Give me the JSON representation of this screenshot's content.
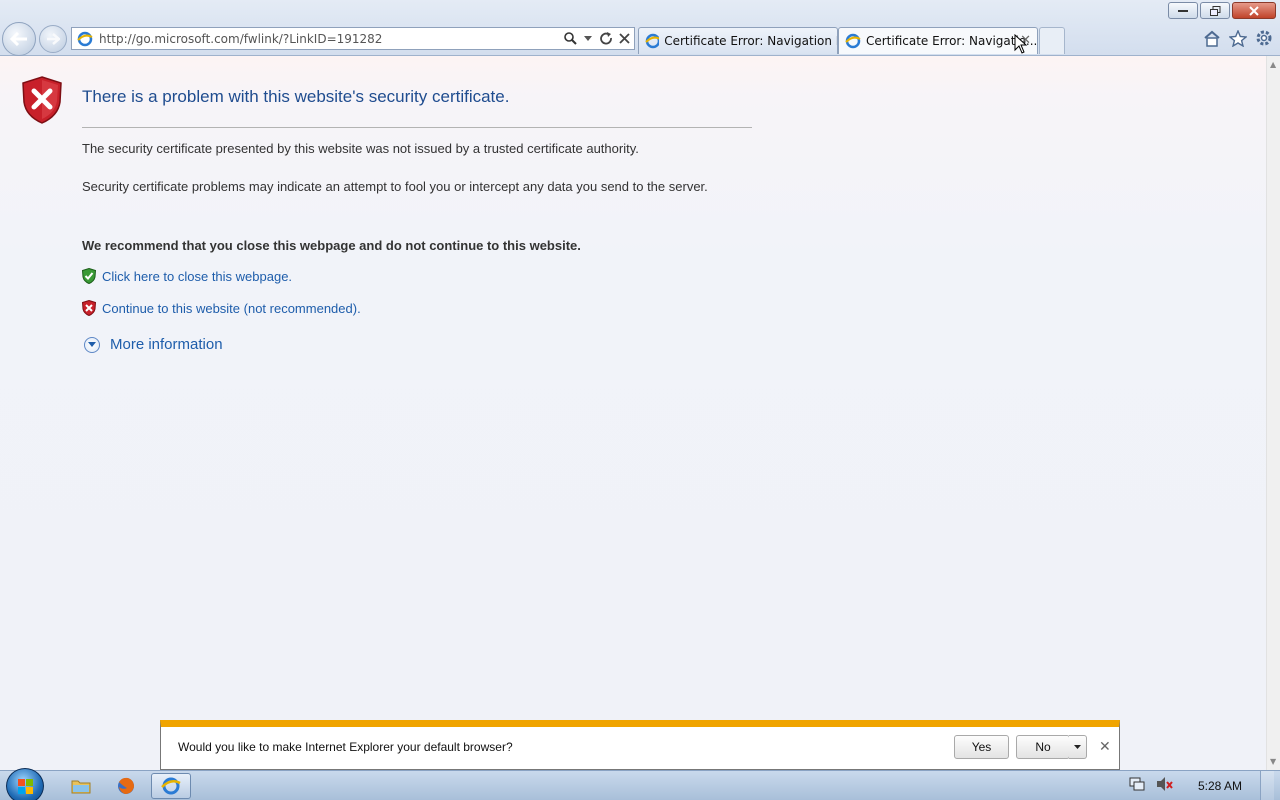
{
  "browser": {
    "address": {
      "url": "http://go.microsoft.com/fwlink/?LinkID=191282"
    },
    "tabs": [
      {
        "label": "Certificate Error: Navigation Bl...",
        "active": false
      },
      {
        "label": "Certificate Error: Navigatio...",
        "active": true
      }
    ]
  },
  "page": {
    "title": "There is a problem with this website's security certificate.",
    "paragraph1": "The security certificate presented by this website was not issued by a trusted certificate authority.",
    "paragraph2": "Security certificate problems may indicate an attempt to fool you or intercept any data you send to the server.",
    "recommendation": "We recommend that you close this webpage and do not continue to this website.",
    "close_link": "Click here to close this webpage.",
    "continue_link": "Continue to this website (not recommended).",
    "more_info": "More information"
  },
  "notification": {
    "message": "Would you like to make Internet Explorer your default browser?",
    "yes_label": "Yes",
    "no_label": "No"
  },
  "taskbar": {
    "clock": "5:28 AM"
  },
  "colors": {
    "link": "#1e5dab",
    "title": "#1f4c8f",
    "notify_accent": "#f0a400",
    "error_red": "#c8202a",
    "safe_green": "#3a9a36"
  },
  "icons": {
    "back": "back-arrow-icon",
    "forward": "forward-arrow-icon",
    "search": "search-icon",
    "refresh": "refresh-icon",
    "stop": "close-icon",
    "home": "home-icon",
    "favorites": "star-icon",
    "tools": "gear-icon",
    "error_shield": "shield-error-icon",
    "safe_shield": "shield-check-icon"
  }
}
